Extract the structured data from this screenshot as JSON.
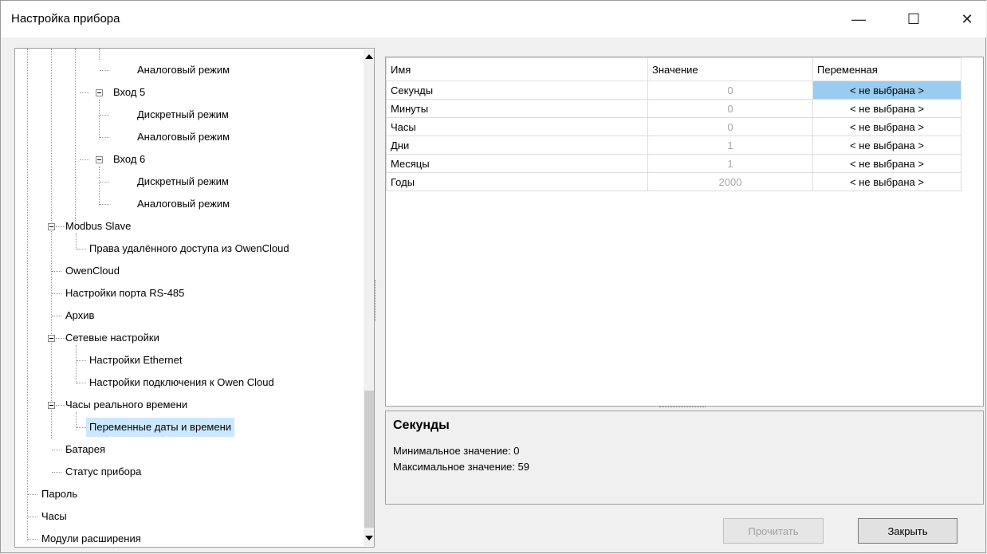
{
  "window": {
    "title": "Настройка прибора",
    "controls": {
      "minimize": "—",
      "maximize": "☐",
      "close": "✕"
    }
  },
  "tree": {
    "items": [
      {
        "label": "Аналоговый режим"
      },
      {
        "label": "Вход 5"
      },
      {
        "label": "Дискретный режим"
      },
      {
        "label": "Аналоговый режим"
      },
      {
        "label": "Вход 6"
      },
      {
        "label": "Дискретный режим"
      },
      {
        "label": "Аналоговый режим"
      },
      {
        "label": "Modbus Slave"
      },
      {
        "label": "Права удалённого доступа из OwenCloud"
      },
      {
        "label": "OwenCloud"
      },
      {
        "label": "Настройки порта RS-485"
      },
      {
        "label": "Архив"
      },
      {
        "label": "Сетевые настройки"
      },
      {
        "label": "Настройки Ethernet"
      },
      {
        "label": "Настройки подключения к Owen Cloud"
      },
      {
        "label": "Часы реального времени"
      },
      {
        "label": "Переменные даты и времени"
      },
      {
        "label": "Батарея"
      },
      {
        "label": "Статус прибора"
      },
      {
        "label": "Пароль"
      },
      {
        "label": "Часы"
      },
      {
        "label": "Модули расширения"
      }
    ]
  },
  "grid": {
    "columns": [
      "Имя",
      "Значение",
      "Переменная"
    ],
    "rows": [
      {
        "name": "Секунды",
        "value": "0",
        "variable": "< не выбрана >"
      },
      {
        "name": "Минуты",
        "value": "0",
        "variable": "< не выбрана >"
      },
      {
        "name": "Часы",
        "value": "0",
        "variable": "< не выбрана >"
      },
      {
        "name": "Дни",
        "value": "1",
        "variable": "< не выбрана >"
      },
      {
        "name": "Месяцы",
        "value": "1",
        "variable": "< не выбрана >"
      },
      {
        "name": "Годы",
        "value": "2000",
        "variable": "< не выбрана >"
      }
    ]
  },
  "info": {
    "title": "Секунды",
    "min": "Минимальное значение: 0",
    "max": "Максимальное значение: 59"
  },
  "buttons": {
    "read": "Прочитать",
    "close": "Закрыть"
  }
}
